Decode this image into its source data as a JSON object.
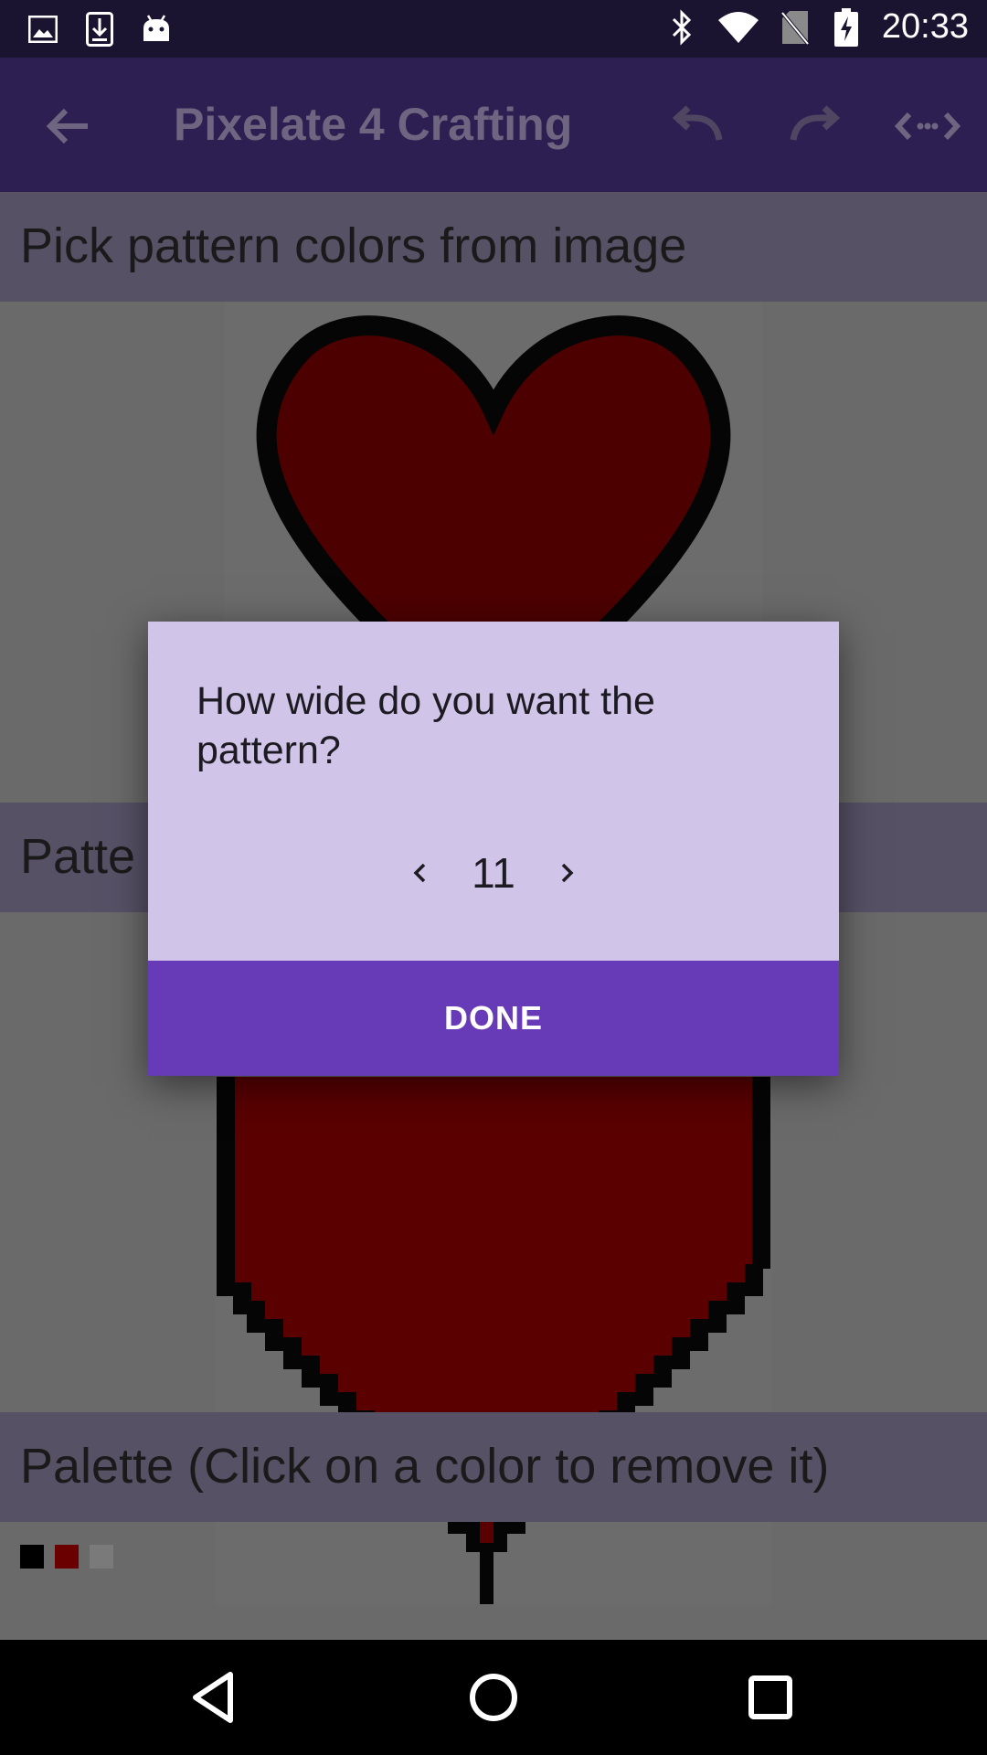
{
  "status_bar": {
    "time": "20:33",
    "left_icons": [
      "image-icon",
      "download-icon",
      "android-icon"
    ],
    "right_icons": [
      "bluetooth-icon",
      "wifi-icon",
      "no-sim-icon",
      "battery-charging-icon"
    ]
  },
  "app_bar": {
    "title": "Pixelate 4 Crafting",
    "actions": [
      "undo-icon",
      "redo-icon",
      "resize-width-icon"
    ]
  },
  "sections": {
    "pick_colors": "Pick pattern colors from image",
    "pattern": "Patte",
    "palette": "Palette (Click on a color to remove it)"
  },
  "palette_colors": [
    "#000000",
    "#6a0000",
    "#dcdcdc"
  ],
  "dialog": {
    "question": "How wide do you want the pattern?",
    "value": "11",
    "done_label": "DONE"
  },
  "colors": {
    "accent": "#673ab7",
    "dialog_bg": "#d1c4e9",
    "app_bar": "#2e1f52",
    "heart_red": "#5a0000"
  }
}
